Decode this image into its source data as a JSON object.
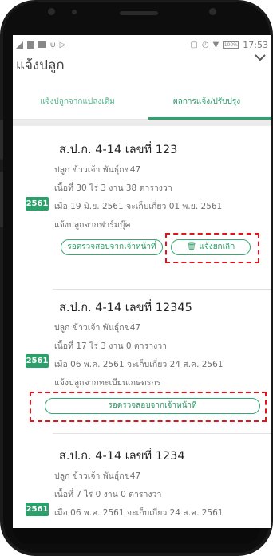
{
  "status_bar": {
    "time": "17:53",
    "battery": "100%"
  },
  "header": {
    "title": "แจ้งปลูก"
  },
  "tabs": [
    {
      "label": "แจ้งปลูกจากแปลงเดิม"
    },
    {
      "label": "ผลการแจ้ง/ปรับปรุง"
    }
  ],
  "records": [
    {
      "title": "ส.ป.ก. 4-14 เลขที่ 123",
      "crop": "ปลูก ข้าวเจ้า พันธุ์กข47",
      "area": "เนื้อที่ 30 ไร่ 3 งาน 38 ตารางวา",
      "year": "2561",
      "dates": "เมื่อ 19 มิ.ย. 2561 จะเก็บเกี่ยว 01 พ.ย. 2561",
      "source": "แจ้งปลูกจากฟาร์มบุ๊ค",
      "status_label": "รอตรวจสอบจากเจ้าหน้าที่",
      "cancel_label": "แจ้งยกเลิก"
    },
    {
      "title": "ส.ป.ก. 4-14 เลขที่ 12345",
      "crop": "ปลูก ข้าวเจ้า พันธุ์กข47",
      "area": "เนื้อที่ 17 ไร่ 3 งาน 0 ตารางวา",
      "year": "2561",
      "dates": "เมื่อ 06 พ.ค. 2561 จะเก็บเกี่ยว 24 ส.ค. 2561",
      "source": "แจ้งปลูกจากทะเบียนเกษตรกร",
      "status_label": "รอตรวจสอบจากเจ้าหน้าที่"
    },
    {
      "title": "ส.ป.ก. 4-14 เลขที่ 1234",
      "crop": "ปลูก ข้าวเจ้า พันธุ์กข47",
      "area": "เนื้อที่ 7 ไร่ 0 งาน 0 ตารางวา",
      "year": "2561",
      "dates": "เมื่อ 06 พ.ค. 2561 จะเก็บเกี่ยว 24 ส.ค. 2561"
    }
  ],
  "colors": {
    "accent": "#2fa36f",
    "highlight": "#e0151b"
  }
}
